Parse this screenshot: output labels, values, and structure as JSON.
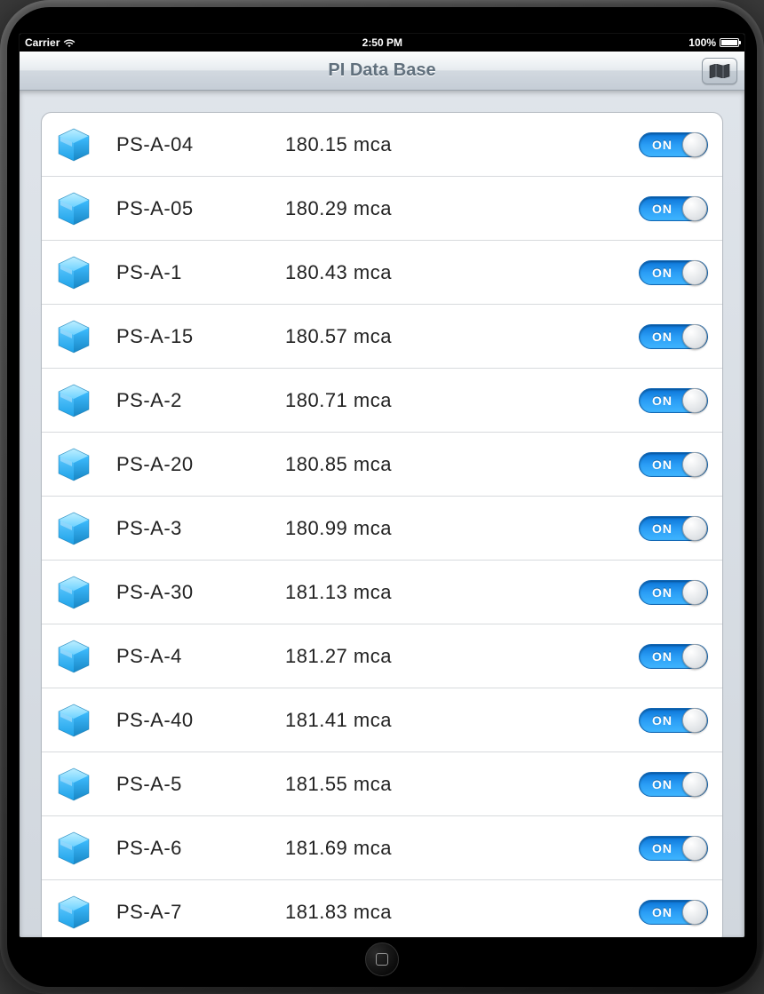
{
  "statusbar": {
    "carrier": "Carrier",
    "time": "2:50 PM",
    "battery_pct": "100%"
  },
  "navbar": {
    "title": "PI Data Base"
  },
  "toggle_on_label": "ON",
  "rows": [
    {
      "tag": "PS-A-04",
      "value": "180.15 mca",
      "on": true
    },
    {
      "tag": "PS-A-05",
      "value": "180.29 mca",
      "on": true
    },
    {
      "tag": "PS-A-1",
      "value": "180.43 mca",
      "on": true
    },
    {
      "tag": "PS-A-15",
      "value": "180.57 mca",
      "on": true
    },
    {
      "tag": "PS-A-2",
      "value": "180.71 mca",
      "on": true
    },
    {
      "tag": "PS-A-20",
      "value": "180.85 mca",
      "on": true
    },
    {
      "tag": "PS-A-3",
      "value": "180.99 mca",
      "on": true
    },
    {
      "tag": "PS-A-30",
      "value": "181.13 mca",
      "on": true
    },
    {
      "tag": "PS-A-4",
      "value": "181.27 mca",
      "on": true
    },
    {
      "tag": "PS-A-40",
      "value": "181.41 mca",
      "on": true
    },
    {
      "tag": "PS-A-5",
      "value": "181.55 mca",
      "on": true
    },
    {
      "tag": "PS-A-6",
      "value": "181.69 mca",
      "on": true
    },
    {
      "tag": "PS-A-7",
      "value": "181.83 mca",
      "on": true
    }
  ]
}
